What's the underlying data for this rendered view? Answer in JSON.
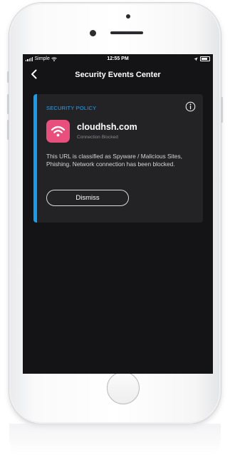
{
  "status_bar": {
    "carrier": "Simple",
    "time": "12:55 PM"
  },
  "nav": {
    "title": "Security Events Center",
    "back_icon": "chevron-left-icon"
  },
  "event": {
    "category": "SECURITY POLICY",
    "domain": "cloudhsh.com",
    "status": "Connection Blocked",
    "description": "This URL is classified as Spyware / Malicious Sites, Phishing. Network connection has been blocked.",
    "dismiss_label": "Dismiss",
    "app_icon": "wifi-icon",
    "info_icon": "info-icon"
  },
  "colors": {
    "accent": "#0fa0f5",
    "category_text": "#1aa7ff",
    "app_icon_bg": "#ea4e7c",
    "screen_bg": "#141416",
    "card_bg": "#232326"
  }
}
